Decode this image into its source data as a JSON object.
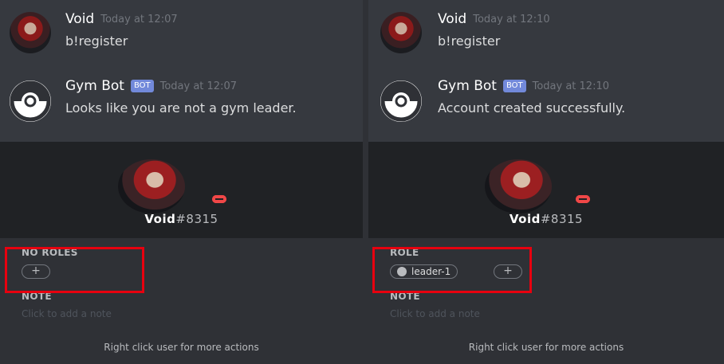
{
  "left": {
    "messages": [
      {
        "author": "Void",
        "time": "Today at 12:07",
        "content": "b!register",
        "avatar_icon": "anime-avatar-icon"
      },
      {
        "author": "Gym Bot",
        "bot_tag": "BOT",
        "time": "Today at 12:07",
        "content": "Looks like you are not a gym leader.",
        "avatar_icon": "pokeball-icon"
      }
    ],
    "profile": {
      "username": "Void",
      "discriminator": "#8315",
      "roles_title": "NO ROLES",
      "add_role_label": "+",
      "note_title": "NOTE",
      "note_placeholder": "Click to add a note",
      "footer": "Right click user for more actions"
    }
  },
  "right": {
    "messages": [
      {
        "author": "Void",
        "time": "Today at 12:10",
        "content": "b!register",
        "avatar_icon": "anime-avatar-icon"
      },
      {
        "author": "Gym Bot",
        "bot_tag": "BOT",
        "time": "Today at 12:10",
        "content": "Account created successfully.",
        "avatar_icon": "pokeball-icon"
      }
    ],
    "profile": {
      "username": "Void",
      "discriminator": "#8315",
      "roles_title": "ROLE",
      "role_name": "leader-1",
      "add_role_label": "+",
      "note_title": "NOTE",
      "note_placeholder": "Click to add a note",
      "footer": "Right click user for more actions"
    }
  },
  "colors": {
    "background": "#36393f",
    "card": "#2f3136",
    "card_header": "#202225",
    "bot_tag": "#7289da",
    "dnd_status": "#f04747",
    "highlight": "#e8000f"
  }
}
